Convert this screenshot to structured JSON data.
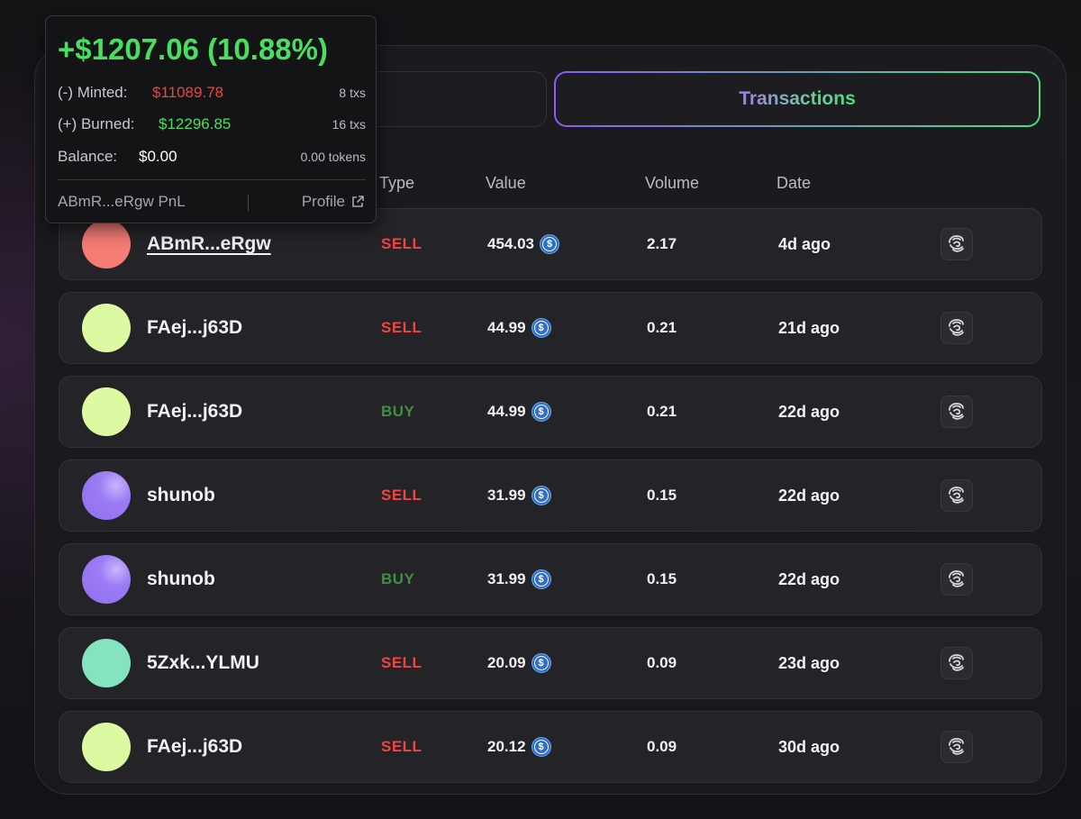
{
  "tabs": {
    "left_label": "",
    "active_label": "Transactions"
  },
  "columns": {
    "type": "Type",
    "value": "Value",
    "volume": "Volume",
    "date": "Date"
  },
  "colors": {
    "sell": "#ef4444",
    "buy": "#3f8f43",
    "pnl_positive": "#4ade60",
    "minted": "#ef4444",
    "burned": "#4ade60",
    "accent_gradient_start": "#8b5cf6",
    "accent_gradient_end": "#4ade80"
  },
  "rows": [
    {
      "name": "ABmR...eRgw",
      "type": "SELL",
      "value": "454.03",
      "volume": "2.17",
      "date": "4d ago",
      "avatar_color": "#f47c74",
      "currency_icon": "usdc-icon",
      "action_icon": "solscan-icon"
    },
    {
      "name": "FAej...j63D",
      "type": "SELL",
      "value": "44.99",
      "volume": "0.21",
      "date": "21d ago",
      "avatar_color": "#ddfaa3",
      "currency_icon": "usdc-icon",
      "action_icon": "solscan-icon"
    },
    {
      "name": "FAej...j63D",
      "type": "BUY",
      "value": "44.99",
      "volume": "0.21",
      "date": "22d ago",
      "avatar_color": "#ddfaa3",
      "currency_icon": "usdc-icon",
      "action_icon": "solscan-icon"
    },
    {
      "name": "shunob",
      "type": "SELL",
      "value": "31.99",
      "volume": "0.15",
      "date": "22d ago",
      "avatar_color": "#9b7cf4",
      "currency_icon": "usdc-icon",
      "action_icon": "solscan-icon"
    },
    {
      "name": "shunob",
      "type": "BUY",
      "value": "31.99",
      "volume": "0.15",
      "date": "22d ago",
      "avatar_color": "#9b7cf4",
      "currency_icon": "usdc-icon",
      "action_icon": "solscan-icon"
    },
    {
      "name": "5Zxk...YLMU",
      "type": "SELL",
      "value": "20.09",
      "volume": "0.09",
      "date": "23d ago",
      "avatar_color": "#86e3c0",
      "currency_icon": "usdc-icon",
      "action_icon": "solscan-icon"
    },
    {
      "name": "FAej...j63D",
      "type": "SELL",
      "value": "20.12",
      "volume": "0.09",
      "date": "30d ago",
      "avatar_color": "#ddfaa3",
      "currency_icon": "usdc-icon",
      "action_icon": "solscan-icon"
    }
  ],
  "tooltip": {
    "pnl": "+$1207.06 (10.88%)",
    "minted_label": "(-) Minted:",
    "minted_value": "$11089.78",
    "minted_txs": "8 txs",
    "burned_label": "(+) Burned:",
    "burned_value": "$12296.85",
    "burned_txs": "16 txs",
    "balance_label": "Balance:",
    "balance_value": "$0.00",
    "balance_tokens": "0.00 tokens",
    "footer_title": "ABmR...eRgw PnL",
    "profile_label": "Profile"
  }
}
